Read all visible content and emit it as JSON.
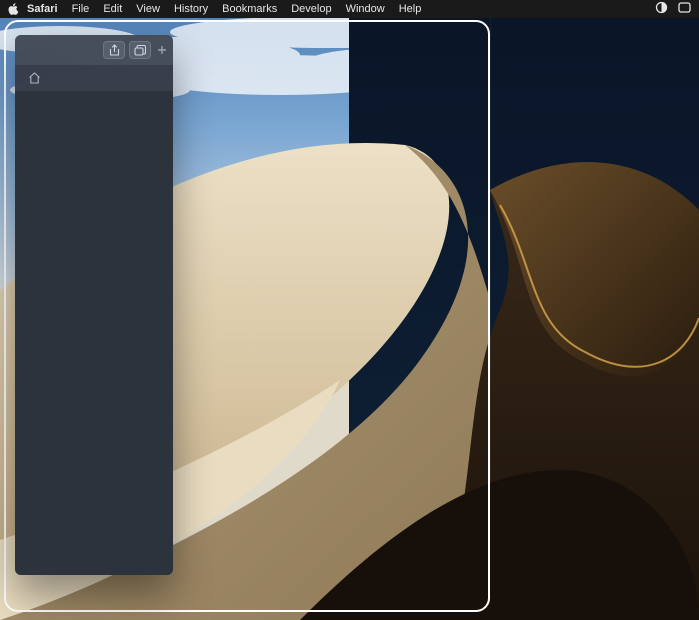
{
  "menubar": {
    "app_name": "Safari",
    "items": [
      "File",
      "Edit",
      "View",
      "History",
      "Bookmarks",
      "Develop",
      "Window",
      "Help"
    ]
  },
  "icons": {
    "apple": "apple-logo",
    "spotlight": "search-icon",
    "control_center": "control-center-icon",
    "share": "share-icon",
    "tabs": "tabs-overview-icon",
    "newtab": "plus-icon",
    "home": "home-icon"
  }
}
